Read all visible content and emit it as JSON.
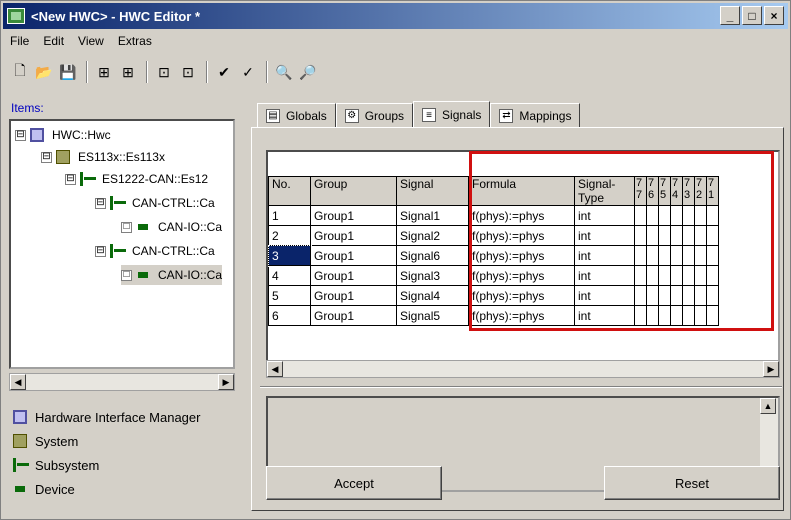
{
  "window": {
    "title": "<New HWC> - HWC Editor  *",
    "minimize": "_",
    "maximize": "□",
    "close": "×"
  },
  "menu": [
    "File",
    "Edit",
    "View",
    "Extras"
  ],
  "left": {
    "items_label": "Items:",
    "tree": [
      {
        "label": "HWC::Hwc",
        "expander": "⊟"
      },
      {
        "label": "ES113x::Es113x",
        "expander": "⊟"
      },
      {
        "label": "ES1222-CAN::Es12",
        "expander": "⊟"
      },
      {
        "label": "CAN-CTRL::Ca",
        "expander": "⊟"
      },
      {
        "label": "CAN-IO::Ca",
        "expander": "□"
      },
      {
        "label": "CAN-CTRL::Ca",
        "expander": "⊟"
      },
      {
        "label": "CAN-IO::Ca",
        "expander": "□"
      }
    ],
    "legend": [
      {
        "label": "Hardware Interface Manager",
        "icon": "hardware-interface-manager-icon"
      },
      {
        "label": "System",
        "icon": "system-icon"
      },
      {
        "label": "Subsystem",
        "icon": "subsystem-icon"
      },
      {
        "label": "Device",
        "icon": "device-icon"
      }
    ]
  },
  "tabs": [
    "Globals",
    "Groups",
    "Signals",
    "Mappings"
  ],
  "grid": {
    "headers": [
      "No.",
      "Group",
      "Signal",
      "Formula",
      "Signal-\nType"
    ],
    "digit_headers": [
      [
        "7",
        "7"
      ],
      [
        "7",
        "6"
      ],
      [
        "7",
        "5"
      ],
      [
        "7",
        "4"
      ],
      [
        "7",
        "3"
      ],
      [
        "7",
        "2"
      ],
      [
        "7",
        "1"
      ]
    ],
    "rows": [
      [
        "1",
        "Group1",
        "Signal1",
        "f(phys):=phys",
        "int"
      ],
      [
        "2",
        "Group1",
        "Signal2",
        "f(phys):=phys",
        "int"
      ],
      [
        "3",
        "Group1",
        "Signal6",
        "f(phys):=phys",
        "int"
      ],
      [
        "4",
        "Group1",
        "Signal3",
        "f(phys):=phys",
        "int"
      ],
      [
        "5",
        "Group1",
        "Signal4",
        "f(phys):=phys",
        "int"
      ],
      [
        "6",
        "Group1",
        "Signal5",
        "f(phys):=phys",
        "int"
      ]
    ]
  },
  "buttons": {
    "accept": "Accept",
    "reset": "Reset"
  }
}
